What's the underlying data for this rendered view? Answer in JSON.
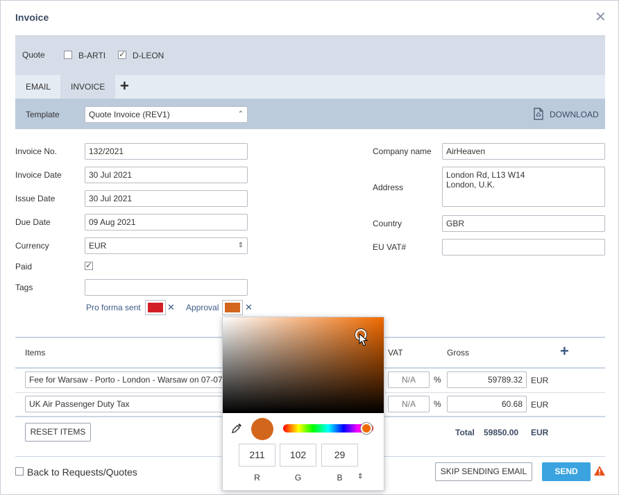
{
  "dialog": {
    "title": "Invoice"
  },
  "quote": {
    "label": "Quote",
    "options": [
      {
        "label": "B-ARTI",
        "checked": false
      },
      {
        "label": "D-LEON",
        "checked": true
      }
    ]
  },
  "tabs": [
    {
      "label": "EMAIL",
      "active": false
    },
    {
      "label": "INVOICE",
      "active": true
    }
  ],
  "template": {
    "label": "Template",
    "value": "Quote Invoice (REV1)",
    "download_label": "DOWNLOAD"
  },
  "fields_left": {
    "invoice_no": {
      "label": "Invoice No.",
      "value": "132/2021"
    },
    "invoice_date": {
      "label": "Invoice Date",
      "value": "30 Jul 2021"
    },
    "issue_date": {
      "label": "Issue Date",
      "value": "30 Jul 2021"
    },
    "due_date": {
      "label": "Due Date",
      "value": "09 Aug 2021"
    },
    "currency": {
      "label": "Currency",
      "value": "EUR"
    },
    "paid": {
      "label": "Paid",
      "checked": true
    },
    "tags": {
      "label": "Tags",
      "value": ""
    }
  },
  "tags_list": [
    {
      "label": "Pro forma sent",
      "color": "#d11f25"
    },
    {
      "label": "Approval",
      "color": "#d3661d"
    }
  ],
  "fields_right": {
    "company": {
      "label": "Company name",
      "value": "AirHeaven"
    },
    "address": {
      "label": "Address",
      "line1": "London Rd, L13 W14",
      "line2": "London, U.K."
    },
    "country": {
      "label": "Country",
      "value": "GBR"
    },
    "eu_vat": {
      "label": "EU VAT#",
      "value": ""
    }
  },
  "items": {
    "headers": {
      "items": "Items",
      "vat": "VAT",
      "gross": "Gross"
    },
    "rows": [
      {
        "name": "Fee for Warsaw - Porto - London - Warsaw on 07-07-2",
        "vat": "N/A",
        "pct": "%",
        "gross": "59789.32",
        "currency": "EUR"
      },
      {
        "name": "UK Air Passenger Duty Tax",
        "vat": "N/A",
        "pct": "%",
        "gross": "60.68",
        "currency": "EUR"
      }
    ],
    "reset_label": "RESET ITEMS",
    "total_label": "Total",
    "total_value": "59850.00",
    "total_currency": "EUR"
  },
  "footer": {
    "back_label": "Back to Requests/Quotes",
    "skip_label": "SKIP SENDING EMAIL",
    "send_label": "SEND"
  },
  "color_picker": {
    "hue_color": "#f06a00",
    "current_color": "#d3661d",
    "r": "211",
    "g": "102",
    "b": "29",
    "r_label": "R",
    "g_label": "G",
    "b_label": "B"
  }
}
